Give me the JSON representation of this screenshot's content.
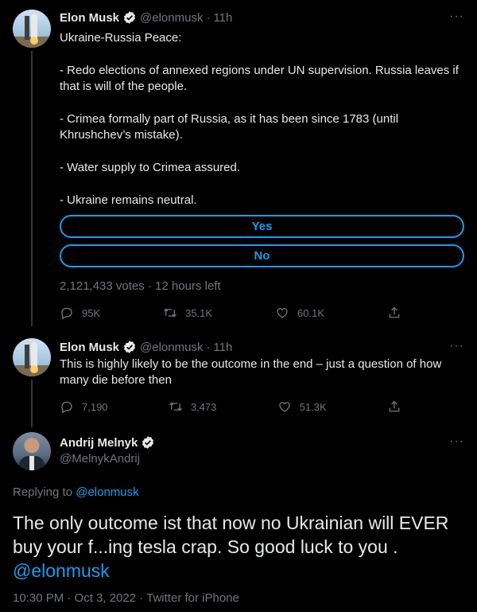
{
  "tweets": [
    {
      "name": "Elon Musk",
      "handle": "@elonmusk",
      "time": "11h",
      "paragraphs": [
        "Ukraine-Russia Peace:",
        "- Redo elections of annexed regions under UN supervision. Russia leaves if that is will of the people.",
        "- Crimea formally part of Russia, as it has been since 1783 (until Khrushchev’s mistake).",
        "- Water supply to Crimea assured.",
        "- Ukraine remains neutral."
      ],
      "poll": {
        "options": [
          "Yes",
          "No"
        ],
        "votes": "2,121,433 votes",
        "time_left": "12 hours left"
      },
      "stats": {
        "replies": "95K",
        "retweets": "35.1K",
        "likes": "60.1K"
      }
    },
    {
      "name": "Elon Musk",
      "handle": "@elonmusk",
      "time": "11h",
      "text": "This is highly likely to be the outcome in the end – just a question of how many die before then",
      "stats": {
        "replies": "7,190",
        "retweets": "3,473",
        "likes": "51.3K"
      }
    }
  ],
  "focused": {
    "name": "Andrij Melnyk",
    "handle": "@MelnykAndrij",
    "replying_to_label": "Replying to",
    "replying_to": "@elonmusk",
    "text": "The only outcome ist that now no Ukrainian will EVER buy your f...ing tesla crap. So good luck to you .",
    "mention": "@elonmusk",
    "timestamp": "10:30 PM · Oct 3, 2022 · Twitter for iPhone"
  },
  "ui": {
    "more": "···",
    "dot": "·"
  },
  "colors": {
    "accent": "#1d9bf0",
    "muted": "#71767b",
    "background": "#000000"
  },
  "icons": [
    "verified-badge-icon",
    "reply-icon",
    "retweet-icon",
    "like-icon",
    "share-icon",
    "more-icon"
  ]
}
